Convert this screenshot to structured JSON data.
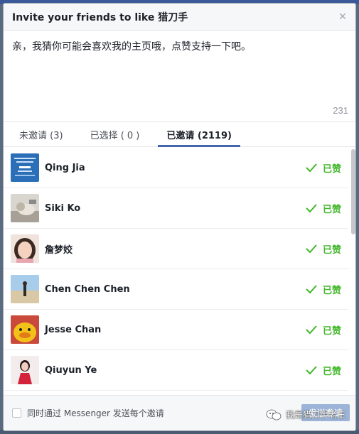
{
  "dialog": {
    "title": "Invite your friends to like 猎刀手",
    "message": "亲，我猜你可能会喜欢我的主页哦，点赞支持一下吧。",
    "char_count": "231"
  },
  "tabs": [
    {
      "label": "未邀请 (3)"
    },
    {
      "label": "已选择 ( 0 )"
    },
    {
      "label": "已邀请 (2119)"
    }
  ],
  "friends": [
    {
      "name": "Qing Jia",
      "status": "已赞"
    },
    {
      "name": "Siki Ko",
      "status": "已赞"
    },
    {
      "name": "詹梦姣",
      "status": "已赞"
    },
    {
      "name": "Chen Chen Chen",
      "status": "已赞"
    },
    {
      "name": "Jesse Chan",
      "status": "已赞"
    },
    {
      "name": "Qiuyun Ye",
      "status": "已赞"
    }
  ],
  "footer": {
    "checkbox_label": "同时通过 Messenger 发送每个邀请",
    "send_label": "发送邀请"
  },
  "watermark": {
    "text": "我是猎刀手老王"
  },
  "colors": {
    "accent": "#4267b2",
    "liked": "#42b72a"
  }
}
